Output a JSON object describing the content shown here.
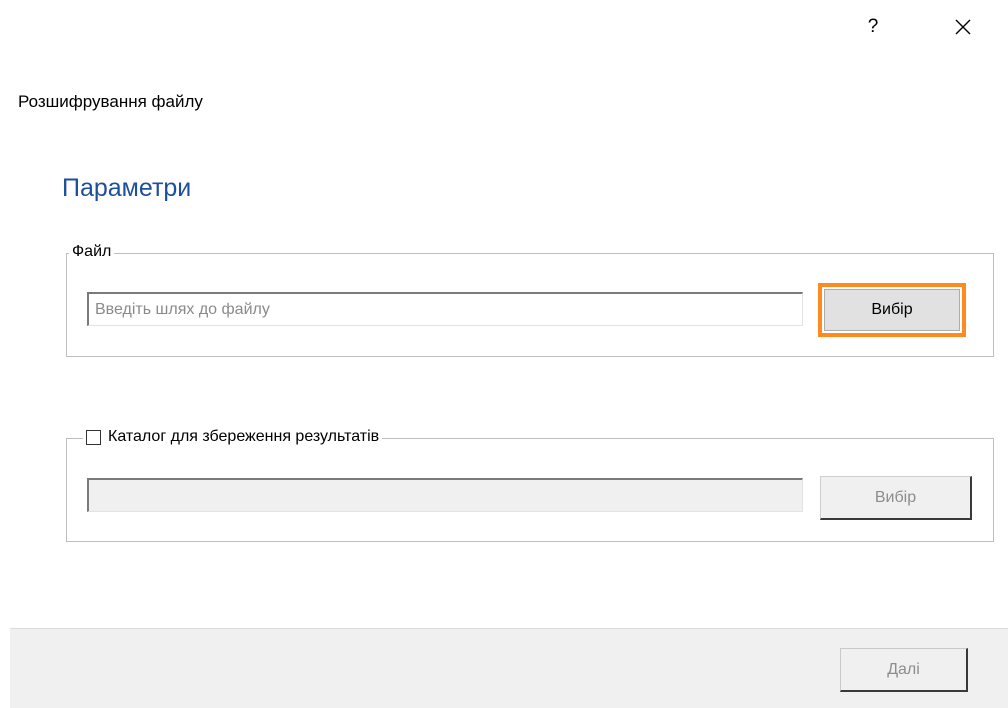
{
  "window": {
    "help_label": "?",
    "close_label": "✕",
    "title": "Розшифрування файлу"
  },
  "section": {
    "title": "Параметри"
  },
  "file_group": {
    "legend": "Файл",
    "input_value": "",
    "input_placeholder": "Введіть шлях до файлу",
    "browse_label": "Вибір",
    "highlight_color": "#ff8a1f"
  },
  "output_group": {
    "checkbox_label": "Каталог для збереження результатів",
    "checked": false,
    "input_value": "",
    "browse_label": "Вибір"
  },
  "footer": {
    "next_label": "Далі"
  }
}
